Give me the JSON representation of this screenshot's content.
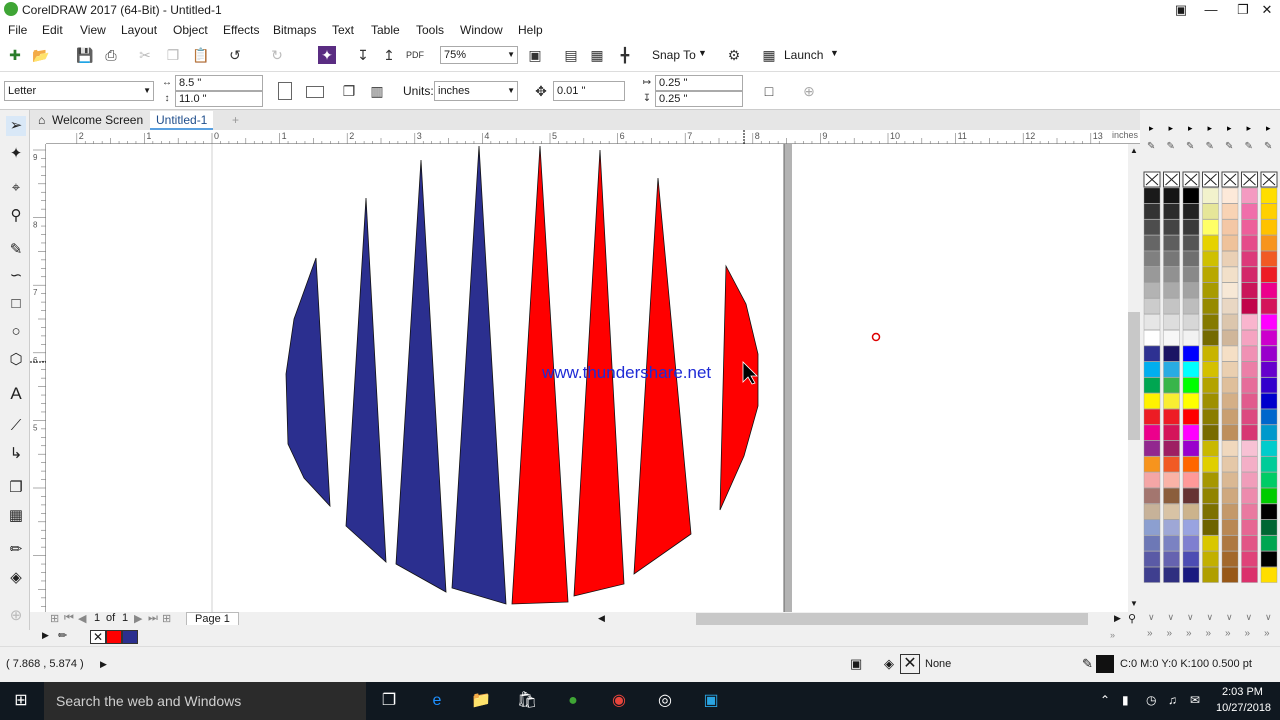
{
  "window": {
    "title": "CorelDRAW 2017 (64-Bit) - Untitled-1"
  },
  "menu": [
    "File",
    "Edit",
    "View",
    "Layout",
    "Object",
    "Effects",
    "Bitmaps",
    "Text",
    "Table",
    "Tools",
    "Window",
    "Help"
  ],
  "toolbar": {
    "zoom": "75%",
    "snap_to": "Snap To",
    "launch": "Launch"
  },
  "propertybar": {
    "page_size": "Letter",
    "width": "8.5 \"",
    "height": "11.0 \"",
    "units_label": "Units:",
    "units": "inches",
    "nudge": "0.01 \"",
    "dup_x": "0.25 \"",
    "dup_y": "0.25 \""
  },
  "tabs": [
    "Welcome Screen",
    "Untitled-1"
  ],
  "ruler": {
    "unit": "inches",
    "top_ticks": [
      "2",
      "1",
      "0",
      "1",
      "2",
      "3",
      "4",
      "5",
      "6",
      "7",
      "8",
      "9",
      "10",
      "11",
      "12",
      "13"
    ],
    "left_ticks": [
      "9",
      "8",
      "7",
      "6",
      "5"
    ]
  },
  "canvas": {
    "watermark_text": "www.thundershare.net"
  },
  "pagenav": {
    "current": "1",
    "of_label": "of",
    "total": "1",
    "page_tab": "Page 1"
  },
  "status": {
    "cursor_coords": "( 7.868 , 5.874 )",
    "fill": "None",
    "outline": "C:0 M:0 Y:0 K:100  0.500 pt"
  },
  "taskbar": {
    "search_placeholder": "Search the web and Windows",
    "time": "2:03 PM",
    "date": "10/27/2018"
  },
  "colors": {
    "red": "#ff0000",
    "blue": "#2b2f8f"
  }
}
